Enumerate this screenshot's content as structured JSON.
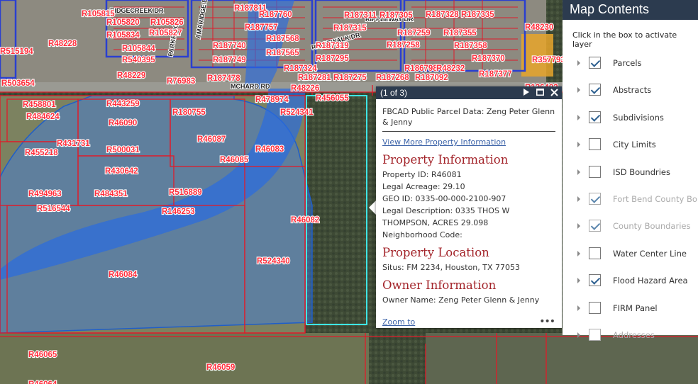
{
  "map": {
    "road_labels": [
      "RIDGECREEK DR",
      "AMARIDGE DR",
      "PARKRIDGE",
      "RIPPLEWAY DR",
      "RIDGEWALK DR",
      "MCHARD RD"
    ],
    "parcel_labels": [
      "R105815",
      "R105820",
      "R105826",
      "R105834",
      "R105827",
      "R105844",
      "R540395",
      "R48229",
      "R76983",
      "R187811",
      "R187760",
      "R187757",
      "R187740",
      "R187568",
      "R187749",
      "R187565",
      "R187478",
      "R187311",
      "R187305",
      "R187328",
      "R187335",
      "R187315",
      "R187259",
      "R187355",
      "R187258",
      "R187358",
      "R187319",
      "R187295",
      "R187324",
      "R187281",
      "R187275",
      "R187268",
      "R187092",
      "R186798",
      "R48232",
      "R187370",
      "R187377",
      "R48230",
      "R357793",
      "R136402",
      "R48228",
      "R515194",
      "R503654",
      "R458801",
      "R484624",
      "R443259",
      "R46090",
      "R180755",
      "R478974",
      "R48226",
      "R456055",
      "R524341",
      "R431731",
      "R455218",
      "R500031",
      "R46087",
      "R46085",
      "R46083",
      "R430642",
      "R494963",
      "R484351",
      "R516889",
      "R516544",
      "R146253",
      "R46082",
      "R524340",
      "R46084",
      "R46065",
      "R46059",
      "R46064"
    ],
    "colors": {
      "parcel_line": "#e01b2a",
      "selected_parcel": "#3ee6e6",
      "flood_zone": "#3b7de8",
      "subdivision": "#2a3fd0",
      "abstract": "#d42020"
    }
  },
  "popup": {
    "counter": "(1 of 3)",
    "icons": {
      "next": "play-icon",
      "maximize": "maximize-icon",
      "close": "close-icon"
    },
    "title": "FBCAD Public Parcel Data: Zeng Peter Glenn & Jenny",
    "more_link": "View More Property Information",
    "property_info": {
      "heading": "Property Information",
      "property_id": "Property ID: R46081",
      "legal_acreage": "Legal Acreage: 29.10",
      "geo_id": "GEO ID: 0335-00-000-2100-907",
      "legal_description": "Legal Description: 0335 THOS W THOMPSON, ACRES 29.098",
      "neighborhood": "Neighborhood Code:"
    },
    "property_location": {
      "heading": "Property Location",
      "situs": "Situs: FM 2234, Houston, TX 77053"
    },
    "owner_info": {
      "heading": "Owner Information",
      "owner_name": "Owner Name: Zeng Peter Glenn & Jenny"
    },
    "zoom_link": "Zoom to",
    "more_icon": "more-dots-icon"
  },
  "panel": {
    "title": "Map Contents",
    "subtitle": "Click in the box to activate layer",
    "layers": [
      {
        "label": "Parcels",
        "checked": true,
        "dim": false
      },
      {
        "label": "Abstracts",
        "checked": true,
        "dim": false
      },
      {
        "label": "Subdivisions",
        "checked": true,
        "dim": false
      },
      {
        "label": "City Limits",
        "checked": false,
        "dim": false
      },
      {
        "label": "ISD Boundries",
        "checked": false,
        "dim": false
      },
      {
        "label": "Fort Bend County Bo",
        "checked": true,
        "dim": true
      },
      {
        "label": "County Boundaries",
        "checked": true,
        "dim": true
      },
      {
        "label": "Water Center Line",
        "checked": false,
        "dim": false
      },
      {
        "label": "Flood Hazard Area",
        "checked": true,
        "dim": false
      },
      {
        "label": "FIRM Panel",
        "checked": false,
        "dim": false
      },
      {
        "label": "Addresses",
        "checked": false,
        "dim": true
      }
    ]
  }
}
